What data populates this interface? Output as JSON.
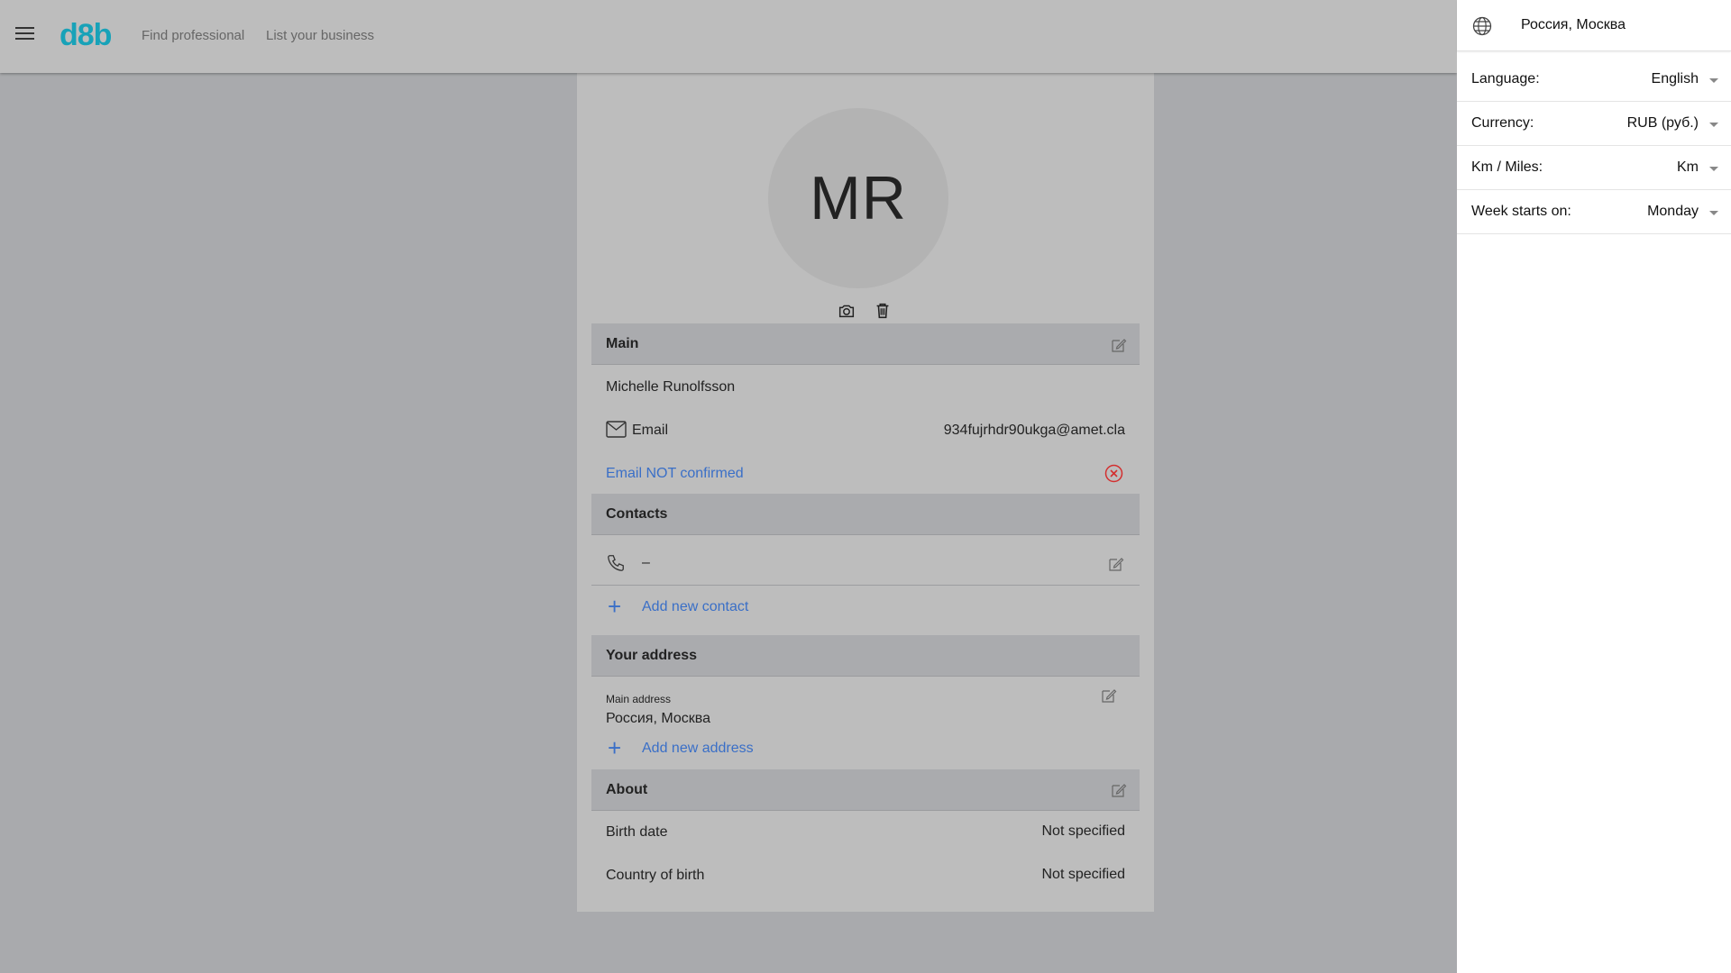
{
  "header": {
    "logo": "d8b",
    "nav": [
      "Find professional",
      "List your business"
    ]
  },
  "profile": {
    "initials": "MR",
    "sections": {
      "main": {
        "title": "Main",
        "name": "Michelle Runolfsson",
        "email_label": "Email",
        "email_value": "934fujrhdr90ukga@amet.cla",
        "email_status": "Email NOT confirmed"
      },
      "contacts": {
        "title": "Contacts",
        "phone_value": "–",
        "add_label": "Add new contact"
      },
      "address": {
        "title": "Your address",
        "main_label": "Main address",
        "main_value": "Россия, Москва",
        "add_label": "Add new address"
      },
      "about": {
        "title": "About",
        "birth_date_label": "Birth date",
        "birth_date_value": "Not specified",
        "country_label": "Country of birth",
        "country_value": "Not specified"
      }
    }
  },
  "settings_panel": {
    "location": "Россия, Москва",
    "rows": [
      {
        "label": "Language:",
        "value": "English"
      },
      {
        "label": "Currency:",
        "value": "RUB (руб.)"
      },
      {
        "label": "Km / Miles:",
        "value": "Km"
      },
      {
        "label": "Week starts on:",
        "value": "Monday"
      }
    ]
  },
  "colors": {
    "brand": "#18a2b8",
    "link": "#3a6fc7",
    "error": "#d32f2f"
  }
}
